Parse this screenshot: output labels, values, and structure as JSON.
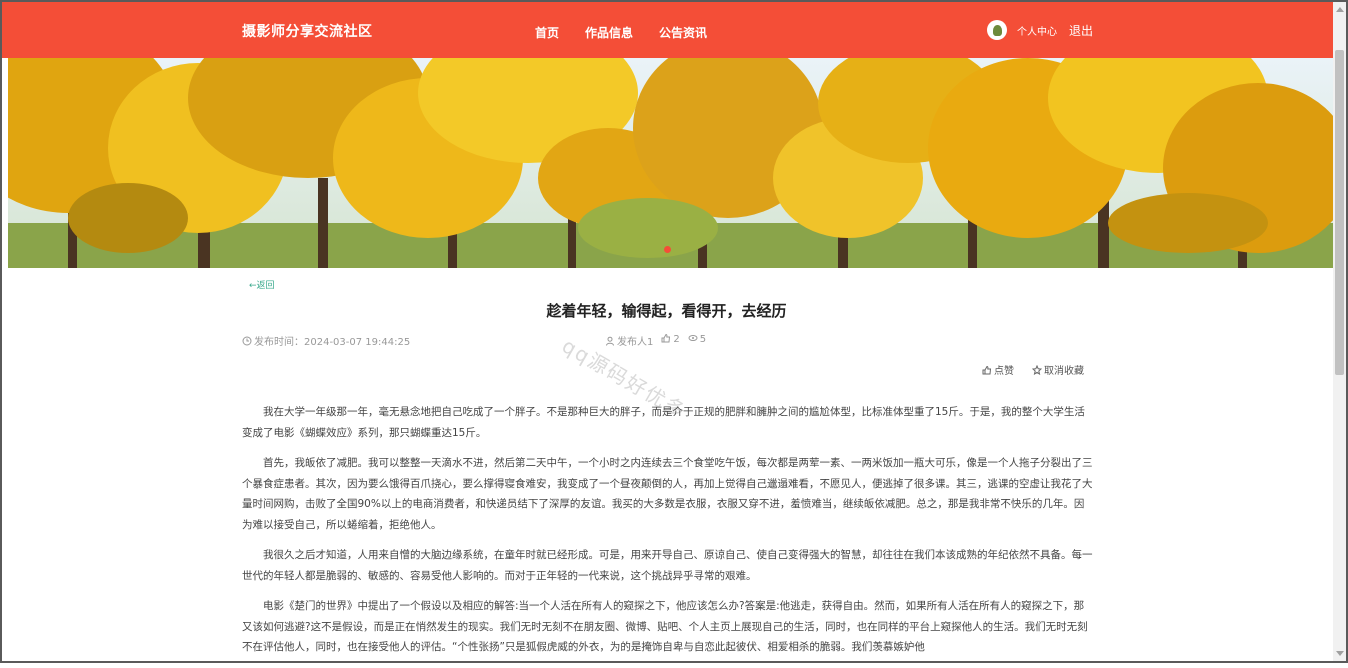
{
  "header": {
    "brand": "摄影师分享交流社区",
    "nav": [
      "首页",
      "作品信息",
      "公告资讯"
    ],
    "user_center": "个人中心",
    "logout": "退出"
  },
  "article": {
    "back": "返回",
    "title": "趁着年轻，输得起，看得开，去经历",
    "publish_time": "发布时间：2024-03-07 19:44:25",
    "author": "发布人1",
    "likes": "2",
    "views": "5",
    "like_label": "点赞",
    "unfavorite_label": "取消收藏",
    "paragraphs": [
      "我在大学一年级那一年，毫无悬念地把自己吃成了一个胖子。不是那种巨大的胖子，而是介于正规的肥胖和臃肿之间的尴尬体型，比标准体型重了15斤。于是，我的整个大学生活变成了电影《蝴蝶效应》系列，那只蝴蝶重达15斤。",
      "首先，我皈依了减肥。我可以整整一天滴水不进，然后第二天中午，一个小时之内连续去三个食堂吃午饭，每次都是两荤一素、一两米饭加一瓶大可乐，像是一个人拖子分裂出了三个暴食症患者。其次，因为要么饿得百爪挠心，要么撑得寝食难安，我变成了一个昼夜颠倒的人，再加上觉得自己邋遢难看，不愿见人，便逃掉了很多课。其三，逃课的空虚让我花了大量时间网购，击败了全国90%以上的电商消费者，和快递员结下了深厚的友谊。我买的大多数是衣服，衣服又穿不进，羞愤难当，继续皈依减肥。总之，那是我非常不快乐的几年。因为难以接受自己，所以蜷缩着，拒绝他人。",
      "我很久之后才知道，人用来自憎的大脑边缘系统，在童年时就已经形成。可是，用来开导自己、原谅自己、使自己变得强大的智慧，却往往在我们本该成熟的年纪依然不具备。每一世代的年轻人都是脆弱的、敏感的、容易受他人影响的。而对于正年轻的一代来说，这个挑战异乎寻常的艰难。",
      "电影《楚门的世界》中提出了一个假设以及相应的解答:当一个人活在所有人的窥探之下，他应该怎么办?答案是:他逃走，获得自由。然而，如果所有人活在所有人的窥探之下，那又该如何逃避?这不是假设，而是正在悄然发生的现实。我们无时无刻不在朋友圈、微博、贴吧、个人主页上展现自己的生活，同时，也在同样的平台上窥探他人的生活。我们无时无刻不在评估他人，同时，也在接受他人的评估。“个性张扬”只是狐假虎威的外衣，为的是掩饰自卑与自恋此起彼伏、相爱相杀的脆弱。我们羡慕嫉妒他"
    ]
  },
  "watermark": "qq源码好优多",
  "colors": {
    "accent": "#f44e37",
    "link": "#3aa98d"
  }
}
